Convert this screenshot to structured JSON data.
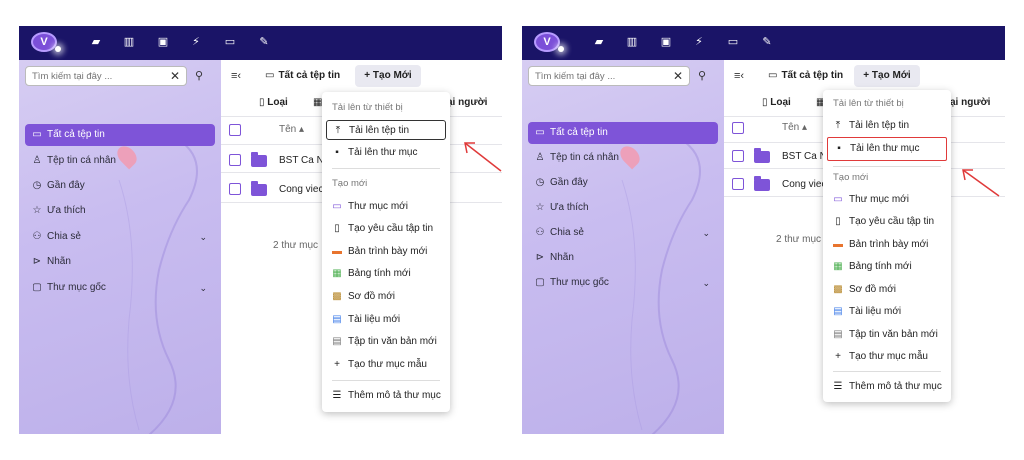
{
  "app": {
    "logo_letter": "V",
    "toolbar_icons": [
      "folder-icon",
      "grid-icon",
      "image-icon",
      "bolt-icon",
      "calendar-icon",
      "pen-icon"
    ]
  },
  "sidebar": {
    "search_placeholder": "Tìm kiếm tại đây ...",
    "items": [
      {
        "label": "Tất cả tệp tin",
        "icon": "folder-icon"
      },
      {
        "label": "Tệp tin cá nhân",
        "icon": "user-icon"
      },
      {
        "label": "Gần đây",
        "icon": "clock-icon"
      },
      {
        "label": "Ưa thích",
        "icon": "star-icon"
      },
      {
        "label": "Chia sẻ",
        "icon": "share-icon"
      },
      {
        "label": "Nhãn",
        "icon": "tag-icon"
      },
      {
        "label": "Thư mục gốc",
        "icon": "folders-icon"
      }
    ]
  },
  "main": {
    "breadcrumb": "Tất cả tệp tin",
    "new_button": "+ Tạo Mới",
    "toolbar_label": "Loại",
    "toolbar_right": "ại người",
    "column_name": "Tên",
    "rows": [
      {
        "name": "BST Ca Nhạc"
      },
      {
        "name": "Cong viec"
      }
    ],
    "count_text": "2 thư mục"
  },
  "menu": {
    "section_upload": "Tải lên từ thiết bị",
    "upload_file": "Tải lên tệp tin",
    "upload_folder": "Tải lên thư mục",
    "section_create": "Tạo mới",
    "new_folder": "Thư mục mới",
    "file_request": "Tạo yêu cầu tập tin",
    "new_presentation": "Bản trình bày mới",
    "new_spreadsheet": "Bảng tính mới",
    "new_diagram": "Sơ đồ mới",
    "new_document": "Tài liệu mới",
    "new_text_file": "Tập tin văn bản mới",
    "new_template_folder": "Tạo thư mục mẫu",
    "add_folder_description": "Thêm mô tả thư mục"
  },
  "colors": {
    "topbar": "#1a1467",
    "accent": "#7e54d8",
    "annotation": "#e03a3a"
  }
}
